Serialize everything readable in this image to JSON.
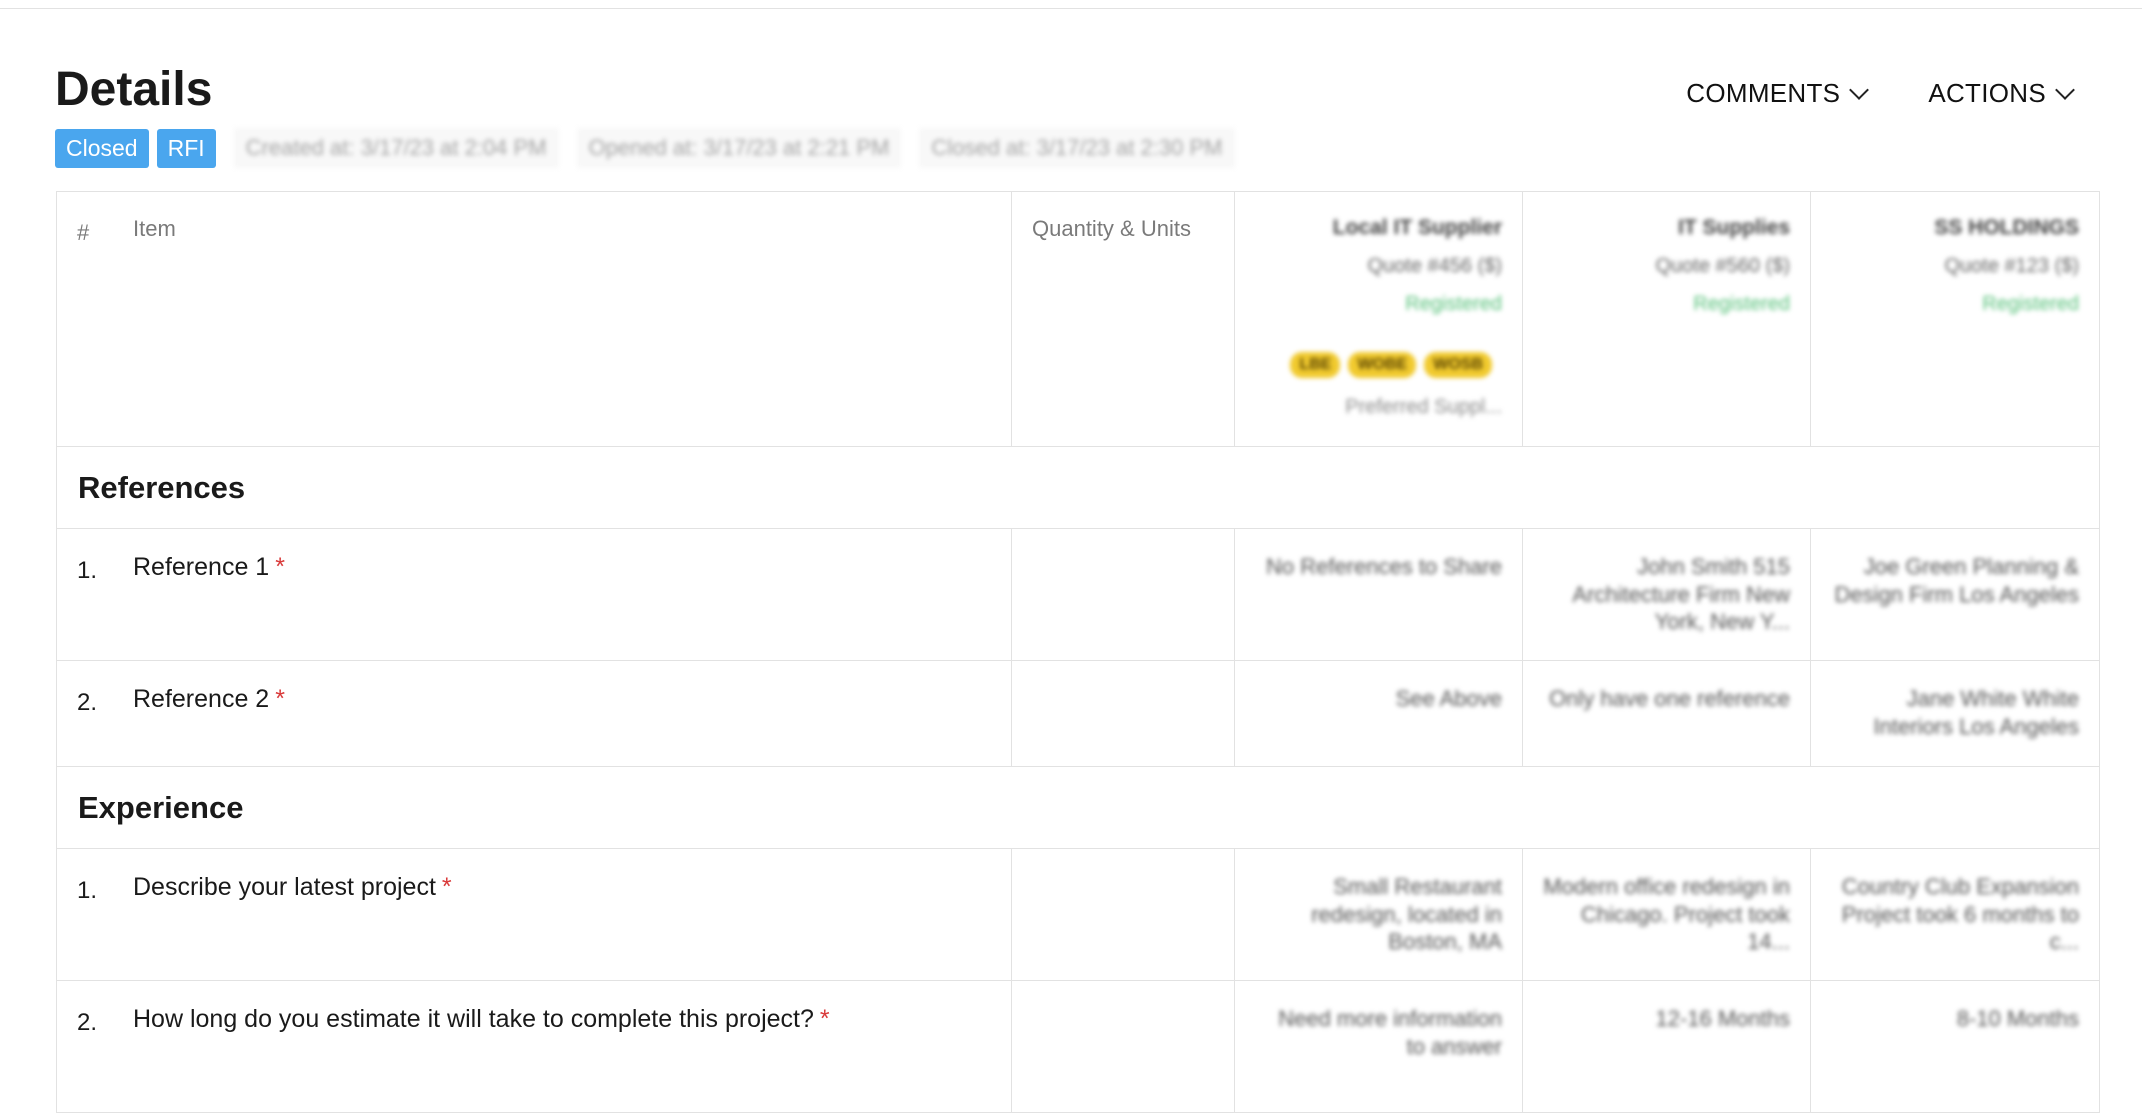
{
  "header": {
    "title": "Details",
    "comments_label": "COMMENTS",
    "actions_label": "ACTIONS"
  },
  "badges": {
    "status": "Closed",
    "type": "RFI",
    "created": "Created at: 3/17/23 at 2:04 PM",
    "opened": "Opened at: 3/17/23 at 2:21 PM",
    "closed": "Closed at: 3/17/23 at 2:30 PM"
  },
  "table": {
    "col_num": "#",
    "col_item": "Item",
    "col_qty": "Quantity & Units",
    "suppliers": [
      {
        "name": "Local IT Supplier",
        "quote": "Quote #456 ($)",
        "status": "Registered",
        "tags": [
          "LBE",
          "WOBE",
          "WOSB"
        ],
        "note": "Preferred Suppl..."
      },
      {
        "name": "IT Supplies",
        "quote": "Quote #560 ($)",
        "status": "Registered"
      },
      {
        "name": "SS HOLDINGS",
        "quote": "Quote #123 ($)",
        "status": "Registered"
      }
    ]
  },
  "sections": [
    {
      "title": "References",
      "items": [
        {
          "num": "1.",
          "label": "Reference 1",
          "required": "*",
          "answers": [
            "No References to Share",
            "John Smith 515 Architecture Firm New York, New Y...",
            "Joe Green Planning & Design Firm Los Angeles"
          ]
        },
        {
          "num": "2.",
          "label": "Reference 2",
          "required": "*",
          "answers": [
            "See Above",
            "Only have one reference",
            "Jane White White Interiors Los Angeles"
          ]
        }
      ]
    },
    {
      "title": "Experience",
      "items": [
        {
          "num": "1.",
          "label": "Describe your latest project",
          "required": "*",
          "answers": [
            "Small Restaurant redesign, located in Boston, MA",
            "Modern office redesign in Chicago. Project took 14...",
            "Country Club Expansion Project took 6 months to c..."
          ]
        },
        {
          "num": "2.",
          "label": "How long do you estimate it will take to complete this project?",
          "required": "*",
          "answers": [
            "Need more information to answer",
            "12-16 Months",
            "8-10 Months"
          ]
        }
      ]
    }
  ]
}
